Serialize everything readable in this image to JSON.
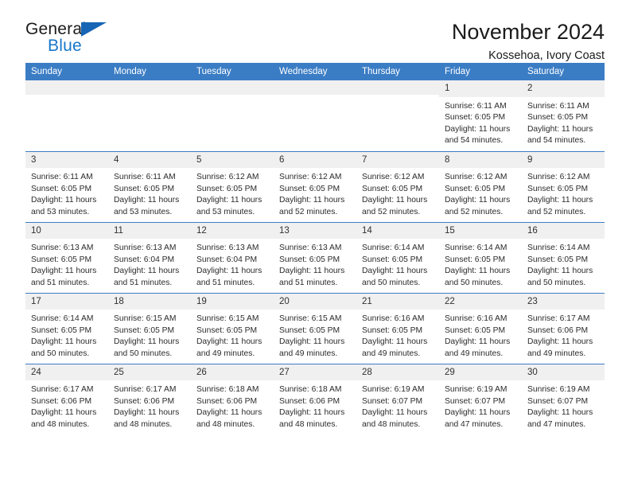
{
  "brand": {
    "name_top": "General",
    "name_bottom": "Blue",
    "triangle_color": "#1665b5",
    "blue_color": "#1877c9"
  },
  "header": {
    "title": "November 2024",
    "subtitle": "Kossehoa, Ivory Coast"
  },
  "theme": {
    "header_row_background": "#3b7dc4",
    "header_row_text": "#ffffff",
    "daynum_background": "#f0f0f0",
    "grid_line": "#3b7dc4"
  },
  "calendar": {
    "weekday_headers": [
      "Sunday",
      "Monday",
      "Tuesday",
      "Wednesday",
      "Thursday",
      "Friday",
      "Saturday"
    ],
    "weeks": [
      [
        {
          "day": "",
          "blank": true
        },
        {
          "day": "",
          "blank": true
        },
        {
          "day": "",
          "blank": true
        },
        {
          "day": "",
          "blank": true
        },
        {
          "day": "",
          "blank": true
        },
        {
          "day": "1",
          "sunrise": "Sunrise: 6:11 AM",
          "sunset": "Sunset: 6:05 PM",
          "daylight_1": "Daylight: 11 hours",
          "daylight_2": "and 54 minutes."
        },
        {
          "day": "2",
          "sunrise": "Sunrise: 6:11 AM",
          "sunset": "Sunset: 6:05 PM",
          "daylight_1": "Daylight: 11 hours",
          "daylight_2": "and 54 minutes."
        }
      ],
      [
        {
          "day": "3",
          "sunrise": "Sunrise: 6:11 AM",
          "sunset": "Sunset: 6:05 PM",
          "daylight_1": "Daylight: 11 hours",
          "daylight_2": "and 53 minutes."
        },
        {
          "day": "4",
          "sunrise": "Sunrise: 6:11 AM",
          "sunset": "Sunset: 6:05 PM",
          "daylight_1": "Daylight: 11 hours",
          "daylight_2": "and 53 minutes."
        },
        {
          "day": "5",
          "sunrise": "Sunrise: 6:12 AM",
          "sunset": "Sunset: 6:05 PM",
          "daylight_1": "Daylight: 11 hours",
          "daylight_2": "and 53 minutes."
        },
        {
          "day": "6",
          "sunrise": "Sunrise: 6:12 AM",
          "sunset": "Sunset: 6:05 PM",
          "daylight_1": "Daylight: 11 hours",
          "daylight_2": "and 52 minutes."
        },
        {
          "day": "7",
          "sunrise": "Sunrise: 6:12 AM",
          "sunset": "Sunset: 6:05 PM",
          "daylight_1": "Daylight: 11 hours",
          "daylight_2": "and 52 minutes."
        },
        {
          "day": "8",
          "sunrise": "Sunrise: 6:12 AM",
          "sunset": "Sunset: 6:05 PM",
          "daylight_1": "Daylight: 11 hours",
          "daylight_2": "and 52 minutes."
        },
        {
          "day": "9",
          "sunrise": "Sunrise: 6:12 AM",
          "sunset": "Sunset: 6:05 PM",
          "daylight_1": "Daylight: 11 hours",
          "daylight_2": "and 52 minutes."
        }
      ],
      [
        {
          "day": "10",
          "sunrise": "Sunrise: 6:13 AM",
          "sunset": "Sunset: 6:05 PM",
          "daylight_1": "Daylight: 11 hours",
          "daylight_2": "and 51 minutes."
        },
        {
          "day": "11",
          "sunrise": "Sunrise: 6:13 AM",
          "sunset": "Sunset: 6:04 PM",
          "daylight_1": "Daylight: 11 hours",
          "daylight_2": "and 51 minutes."
        },
        {
          "day": "12",
          "sunrise": "Sunrise: 6:13 AM",
          "sunset": "Sunset: 6:04 PM",
          "daylight_1": "Daylight: 11 hours",
          "daylight_2": "and 51 minutes."
        },
        {
          "day": "13",
          "sunrise": "Sunrise: 6:13 AM",
          "sunset": "Sunset: 6:05 PM",
          "daylight_1": "Daylight: 11 hours",
          "daylight_2": "and 51 minutes."
        },
        {
          "day": "14",
          "sunrise": "Sunrise: 6:14 AM",
          "sunset": "Sunset: 6:05 PM",
          "daylight_1": "Daylight: 11 hours",
          "daylight_2": "and 50 minutes."
        },
        {
          "day": "15",
          "sunrise": "Sunrise: 6:14 AM",
          "sunset": "Sunset: 6:05 PM",
          "daylight_1": "Daylight: 11 hours",
          "daylight_2": "and 50 minutes."
        },
        {
          "day": "16",
          "sunrise": "Sunrise: 6:14 AM",
          "sunset": "Sunset: 6:05 PM",
          "daylight_1": "Daylight: 11 hours",
          "daylight_2": "and 50 minutes."
        }
      ],
      [
        {
          "day": "17",
          "sunrise": "Sunrise: 6:14 AM",
          "sunset": "Sunset: 6:05 PM",
          "daylight_1": "Daylight: 11 hours",
          "daylight_2": "and 50 minutes."
        },
        {
          "day": "18",
          "sunrise": "Sunrise: 6:15 AM",
          "sunset": "Sunset: 6:05 PM",
          "daylight_1": "Daylight: 11 hours",
          "daylight_2": "and 50 minutes."
        },
        {
          "day": "19",
          "sunrise": "Sunrise: 6:15 AM",
          "sunset": "Sunset: 6:05 PM",
          "daylight_1": "Daylight: 11 hours",
          "daylight_2": "and 49 minutes."
        },
        {
          "day": "20",
          "sunrise": "Sunrise: 6:15 AM",
          "sunset": "Sunset: 6:05 PM",
          "daylight_1": "Daylight: 11 hours",
          "daylight_2": "and 49 minutes."
        },
        {
          "day": "21",
          "sunrise": "Sunrise: 6:16 AM",
          "sunset": "Sunset: 6:05 PM",
          "daylight_1": "Daylight: 11 hours",
          "daylight_2": "and 49 minutes."
        },
        {
          "day": "22",
          "sunrise": "Sunrise: 6:16 AM",
          "sunset": "Sunset: 6:05 PM",
          "daylight_1": "Daylight: 11 hours",
          "daylight_2": "and 49 minutes."
        },
        {
          "day": "23",
          "sunrise": "Sunrise: 6:17 AM",
          "sunset": "Sunset: 6:06 PM",
          "daylight_1": "Daylight: 11 hours",
          "daylight_2": "and 49 minutes."
        }
      ],
      [
        {
          "day": "24",
          "sunrise": "Sunrise: 6:17 AM",
          "sunset": "Sunset: 6:06 PM",
          "daylight_1": "Daylight: 11 hours",
          "daylight_2": "and 48 minutes."
        },
        {
          "day": "25",
          "sunrise": "Sunrise: 6:17 AM",
          "sunset": "Sunset: 6:06 PM",
          "daylight_1": "Daylight: 11 hours",
          "daylight_2": "and 48 minutes."
        },
        {
          "day": "26",
          "sunrise": "Sunrise: 6:18 AM",
          "sunset": "Sunset: 6:06 PM",
          "daylight_1": "Daylight: 11 hours",
          "daylight_2": "and 48 minutes."
        },
        {
          "day": "27",
          "sunrise": "Sunrise: 6:18 AM",
          "sunset": "Sunset: 6:06 PM",
          "daylight_1": "Daylight: 11 hours",
          "daylight_2": "and 48 minutes."
        },
        {
          "day": "28",
          "sunrise": "Sunrise: 6:19 AM",
          "sunset": "Sunset: 6:07 PM",
          "daylight_1": "Daylight: 11 hours",
          "daylight_2": "and 48 minutes."
        },
        {
          "day": "29",
          "sunrise": "Sunrise: 6:19 AM",
          "sunset": "Sunset: 6:07 PM",
          "daylight_1": "Daylight: 11 hours",
          "daylight_2": "and 47 minutes."
        },
        {
          "day": "30",
          "sunrise": "Sunrise: 6:19 AM",
          "sunset": "Sunset: 6:07 PM",
          "daylight_1": "Daylight: 11 hours",
          "daylight_2": "and 47 minutes."
        }
      ]
    ]
  }
}
